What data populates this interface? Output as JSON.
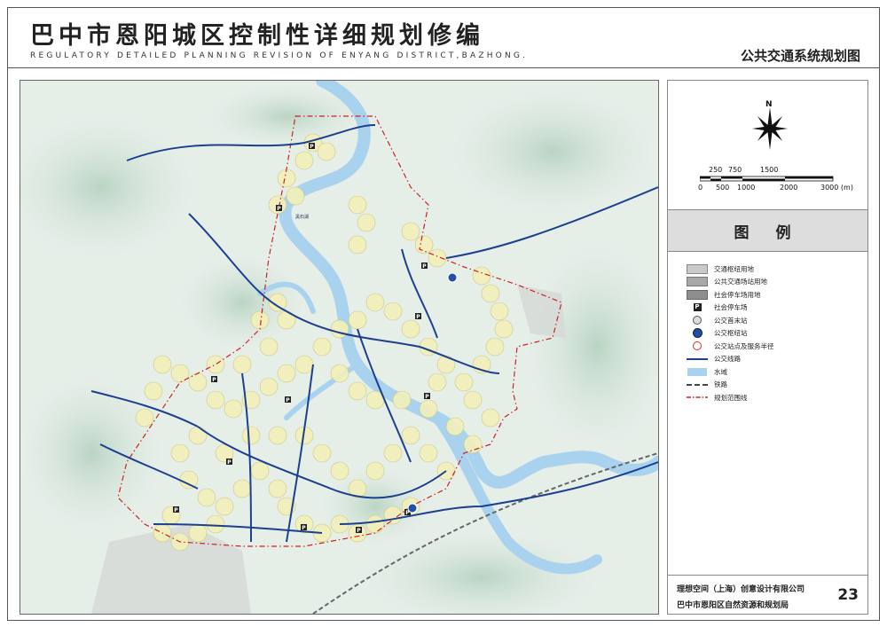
{
  "header": {
    "title": "巴中市恩阳城区控制性详细规划修编",
    "subtitle": "REGULATORY DETAILED PLANNING REVISION OF ENYANG DISTRICT,BAZHONG.",
    "map_name": "公共交通系统规划图"
  },
  "compass": {
    "letter": "N"
  },
  "scale": {
    "top_labels": [
      "250",
      "750",
      "1500"
    ],
    "bottom_labels": [
      "0",
      "500",
      "1000",
      "2000",
      "3000 (m)"
    ]
  },
  "legend": {
    "title": "图 例",
    "items": [
      {
        "label": "交通枢纽用地",
        "symbol": "fill",
        "color": "#c9c9c9"
      },
      {
        "label": "公共交通场站用地",
        "symbol": "fill",
        "color": "#a8a8a8"
      },
      {
        "label": "社会停车场用地",
        "symbol": "fill",
        "color": "#8e8e8e"
      },
      {
        "label": "社会停车场",
        "symbol": "parking-icon",
        "color": "#222222"
      },
      {
        "label": "公交首末站",
        "symbol": "bus-terminal-icon",
        "color": "#555555"
      },
      {
        "label": "公交枢纽站",
        "symbol": "bus-hub-icon",
        "color": "#1f4fa8"
      },
      {
        "label": "公交站点及服务半径",
        "symbol": "bus-stop-radius-icon",
        "color": "#d33a2a"
      },
      {
        "label": "公交线路",
        "symbol": "line",
        "color": "#1d3f8f"
      },
      {
        "label": "水域",
        "symbol": "fill",
        "color": "#a8d2ee"
      },
      {
        "label": "铁路",
        "symbol": "railway",
        "color": "#444444"
      },
      {
        "label": "规划范围线",
        "symbol": "dashdot",
        "color": "#cc2222"
      }
    ]
  },
  "footer": {
    "company": "理想空间（上海）创意设计有限公司",
    "bureau": "巴中市恩阳区自然资源和规划局",
    "page": "23"
  },
  "colors": {
    "terrain": "#e8efe9",
    "hills": "#c8dccf",
    "water": "#a8d2ee",
    "bus_line": "#1d3f8f",
    "service_radius": "#f3f0b9",
    "boundary": "#cc2222"
  }
}
